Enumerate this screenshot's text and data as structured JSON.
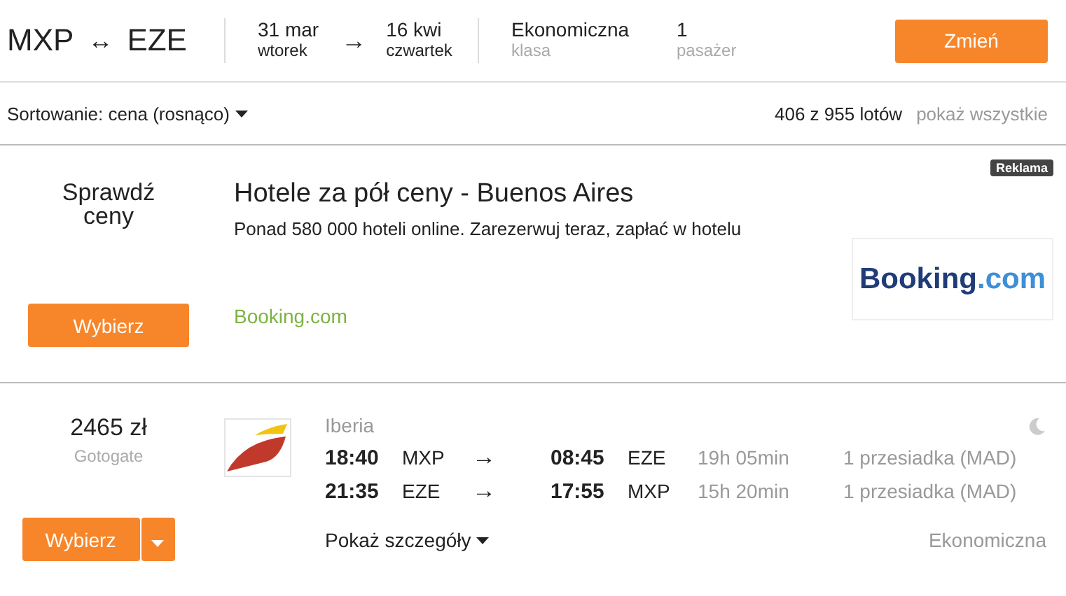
{
  "search": {
    "from": "MXP",
    "arrow": "↔",
    "to": "EZE",
    "depart": {
      "date": "31 mar",
      "day": "wtorek"
    },
    "date_arrow": "→",
    "return": {
      "date": "16 kwi",
      "day": "czwartek"
    },
    "class": {
      "value": "Ekonomiczna",
      "label": "klasa"
    },
    "passengers": {
      "value": "1",
      "label": "pasażer"
    },
    "button": "Zmień"
  },
  "sort_bar": {
    "sort": "Sortowanie: cena (rosnąco)",
    "count": "406 z 955 lotów",
    "show_all": "pokaż wszystkie"
  },
  "ad": {
    "check": "Sprawdź ceny",
    "button": "Wybierz",
    "title": "Hotele za pół ceny - Buenos Aires",
    "text": "Ponad 580 000 hoteli online. Zarezerwuj teraz, zapłać w hotelu",
    "link": "Booking.com",
    "badge": "Reklama",
    "logo_main": "Booking",
    "logo_suffix": ".com"
  },
  "flight": {
    "price": "2465 zł",
    "seller": "Gotogate",
    "button": "Wybierz",
    "airline": "Iberia",
    "legs": [
      {
        "dep": "18:40",
        "from": "MXP",
        "arrow": "→",
        "arr": "08:45",
        "to": "EZE",
        "duration": "19h 05min",
        "stops": "1 przesiadka (MAD)"
      },
      {
        "dep": "21:35",
        "from": "EZE",
        "arrow": "→",
        "arr": "17:55",
        "to": "MXP",
        "duration": "15h 20min",
        "stops": "1 przesiadka (MAD)"
      }
    ],
    "details": "Pokaż szczegóły",
    "class": "Ekonomiczna"
  }
}
